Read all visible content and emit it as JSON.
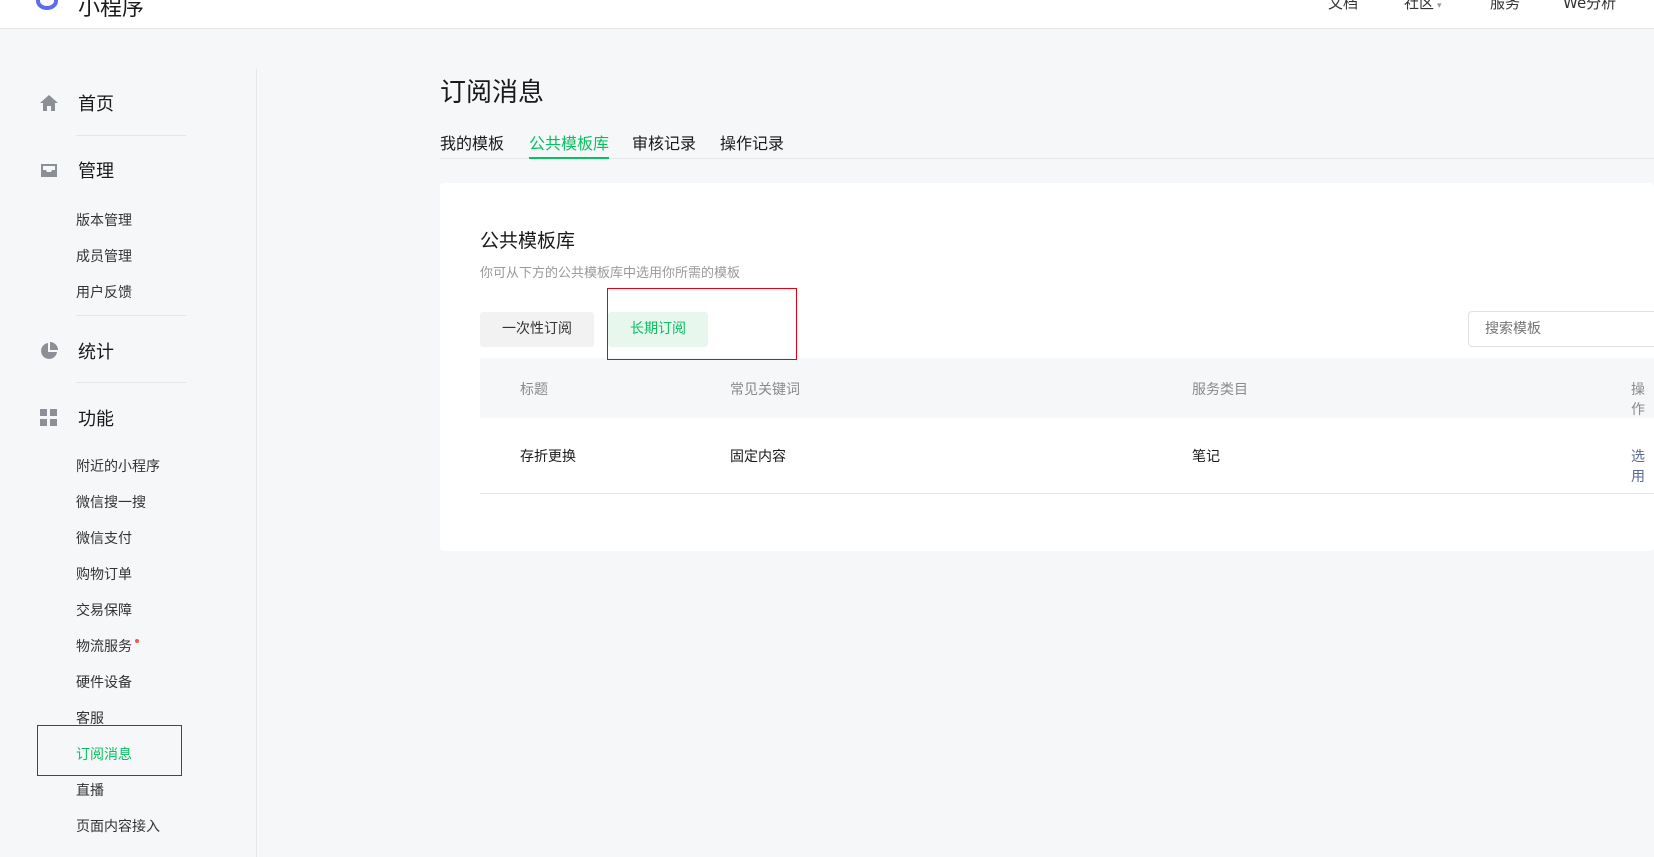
{
  "header": {
    "brand": "小程序",
    "nav": {
      "docs": "文档",
      "community": "社区",
      "service": "服务",
      "analysis": "We分析"
    }
  },
  "sidebar": {
    "home": "首页",
    "manage": {
      "label": "管理",
      "items": [
        "版本管理",
        "成员管理",
        "用户反馈"
      ]
    },
    "stats": "统计",
    "features": {
      "label": "功能",
      "items": [
        "附近的小程序",
        "微信搜一搜",
        "微信支付",
        "购物订单",
        "交易保障",
        "物流服务",
        "硬件设备",
        "客服",
        "订阅消息",
        "直播",
        "页面内容接入"
      ]
    },
    "active_item": "订阅消息",
    "colors": {
      "active": "#07c160",
      "badge": "#fa5151"
    }
  },
  "main": {
    "title": "订阅消息",
    "tabs": [
      "我的模板",
      "公共模板库",
      "审核记录",
      "操作记录"
    ],
    "active_tab": "公共模板库",
    "card": {
      "title": "公共模板库",
      "desc": "你可从下方的公共模板库中选用你所需的模板",
      "segments": [
        "一次性订阅",
        "长期订阅"
      ],
      "active_segment": "长期订阅",
      "search_placeholder": "搜索模板",
      "table": {
        "columns": [
          "标题",
          "常见关键词",
          "服务类目",
          "操作"
        ],
        "rows": [
          {
            "title": "存折更换",
            "keywords": "固定内容",
            "category": "笔记",
            "action": "选用"
          }
        ]
      }
    }
  }
}
